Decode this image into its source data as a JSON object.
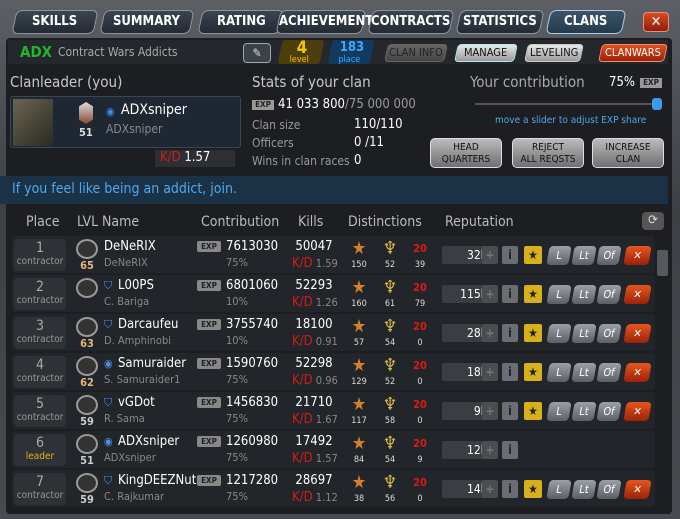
{
  "tabs": [
    {
      "label": "SKILLS"
    },
    {
      "label": "SUMMARY"
    },
    {
      "label": "RATING"
    },
    {
      "label": "ACHIEVEMENTS"
    },
    {
      "label": "CONTRACTS"
    },
    {
      "label": "STATISTICS"
    },
    {
      "label": "CLANS",
      "active": true
    }
  ],
  "close_label": "✕",
  "clan": {
    "tag": "ADX",
    "name": "Contract Wars Addicts",
    "level": "4",
    "level_label": "level",
    "place": "183",
    "place_label": "place",
    "buttons": [
      "CLAN INFO",
      "MANAGE",
      "LEVELING",
      "CLANWARS"
    ]
  },
  "leader": {
    "heading": "Clanleader  (you)",
    "nick": "ADXsniper",
    "real": "ADXsniper",
    "level": "51",
    "kd_label": "K/D",
    "kd": "1.57"
  },
  "stats": {
    "heading": "Stats of your clan",
    "exp_badge": "EXP",
    "exp": "41 033 800",
    "exp_max": "/75 000 000",
    "rows": [
      {
        "label": "Clan size",
        "value": "110/110"
      },
      {
        "label": "Officers",
        "value": "0 /11"
      },
      {
        "label": "Wins in clan races",
        "value": "0"
      }
    ]
  },
  "contribution": {
    "heading": "Your contribution",
    "value": "75%",
    "exp_badge": "EXP",
    "hint": "move a slider to adjust EXP share",
    "slider_percent": 100
  },
  "actions": [
    "HEAD\nQUARTERS",
    "REJECT\nALL REQSTS",
    "INCREASE\nCLAN"
  ],
  "motto": "If you feel like being an addict, join.",
  "columns": {
    "place": "Place",
    "lvl": "LVL",
    "name": "Name",
    "contribution": "Contribution",
    "kills": "Kills",
    "distinctions": "Distinctions",
    "reputation": "Reputation"
  },
  "members": [
    {
      "place": "1",
      "role": "contractor",
      "level": "65",
      "nick": "DeNeRIX",
      "real": "DeNeRIX",
      "icon": "",
      "contribution": "7613030",
      "share": "75%",
      "kills": "50047",
      "kd": "1.59",
      "d1": "150",
      "d2": "52",
      "d3": "39",
      "rep": "32k",
      "manage": true
    },
    {
      "place": "2",
      "role": "contractor",
      "level": "",
      "nick": "L00PS",
      "real": "C. Bariga",
      "icon": "shield",
      "contribution": "6801060",
      "share": "10%",
      "kills": "52293",
      "kd": "1.26",
      "d1": "160",
      "d2": "61",
      "d3": "79",
      "rep": "115k",
      "manage": true
    },
    {
      "place": "3",
      "role": "contractor",
      "level": "63",
      "nick": "Darcaufeu",
      "real": "D. Amphinobi",
      "icon": "shield",
      "contribution": "3755740",
      "share": "10%",
      "kills": "18100",
      "kd": "0.91",
      "d1": "57",
      "d2": "54",
      "d3": "0",
      "rep": "28k",
      "manage": true
    },
    {
      "place": "4",
      "role": "contractor",
      "level": "62",
      "nick": "Samuraider",
      "real": "S. Samuraider1",
      "icon": "eye",
      "contribution": "1590760",
      "share": "75%",
      "kills": "52298",
      "kd": "0.96",
      "d1": "129",
      "d2": "52",
      "d3": "0",
      "rep": "18k",
      "manage": true
    },
    {
      "place": "5",
      "role": "contractor",
      "level": "59",
      "nick": "vGDot",
      "real": "R. Sama",
      "icon": "shield",
      "contribution": "1456830",
      "share": "75%",
      "kills": "21710",
      "kd": "1.67",
      "d1": "117",
      "d2": "58",
      "d3": "0",
      "rep": "9k",
      "manage": true
    },
    {
      "place": "6",
      "role": "leader",
      "level": "51",
      "nick": "ADXsniper",
      "real": "ADXsniper",
      "icon": "eye",
      "contribution": "1260980",
      "share": "75%",
      "kills": "17492",
      "kd": "1.57",
      "d1": "84",
      "d2": "54",
      "d3": "9",
      "rep": "12k",
      "manage": false
    },
    {
      "place": "7",
      "role": "contractor",
      "level": "59",
      "nick": "KingDEEZNuts",
      "real": "C. Rajkumar",
      "icon": "shield",
      "contribution": "1217280",
      "share": "75%",
      "kills": "28697",
      "kd": "1.12",
      "d1": "38",
      "d2": "56",
      "d3": "0",
      "rep": "14k",
      "manage": true
    }
  ],
  "row_labels": {
    "exp": "EXP",
    "kd": "K/D",
    "plus": "+",
    "info": "i",
    "star": "★",
    "l": "L",
    "lt": "Lt",
    "of": "Of",
    "kick": "✕",
    "d3_badge": "20"
  },
  "colors": {
    "accent": "#4ea9ef",
    "kd": "#d21c1c",
    "tag": "#23b52a",
    "leader": "#e7b21c",
    "level": "#e7c21c",
    "place": "#3a9bf0"
  }
}
